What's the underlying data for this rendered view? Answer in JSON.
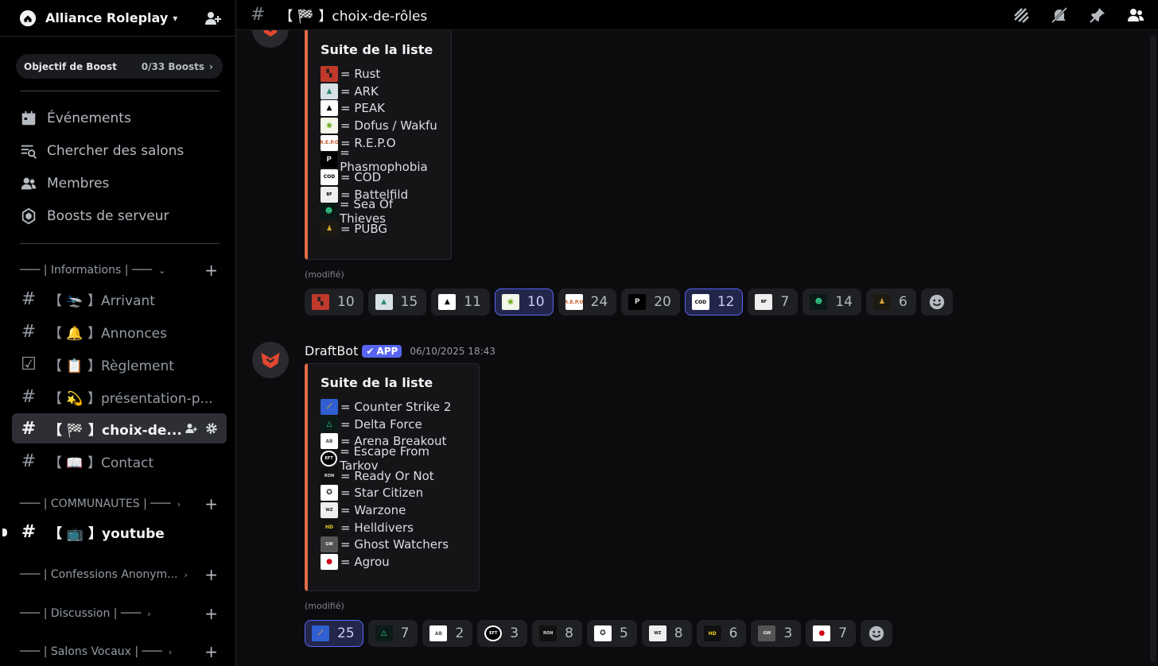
{
  "server": {
    "name": "Alliance Roleplay"
  },
  "boost": {
    "label": "Objectif de Boost",
    "count": "0/33 Boosts"
  },
  "menu": [
    {
      "label": "Événements",
      "icon": "calendar-icon"
    },
    {
      "label": "Chercher des salons",
      "icon": "channel-search-icon"
    },
    {
      "label": "Membres",
      "icon": "members-icon"
    },
    {
      "label": "Boosts de serveur",
      "icon": "boost-icon"
    }
  ],
  "categories": {
    "informations": "─── | Informations | ───",
    "communautes": "─── | COMMUNAUTES | ───",
    "confessions": "─── | Confessions Anonym...",
    "discussion": "─── | Discussion | ───",
    "vocaux": "─── | Salons Vocaux | ───"
  },
  "channels": {
    "arrivant": "【 🛬 】Arrivant",
    "annonces": "【 🔔 】Annonces",
    "reglement": "【 📋 】Règlement",
    "presentation": "【 💫 】présentation-p...",
    "choix": "【 🏁 】choix-de...",
    "contact": "【 📖 】Contact",
    "youtube": "【 📺 】youtube"
  },
  "topbar": {
    "title": "【 🏁 】choix-de-rôles"
  },
  "embed1": {
    "title": "Suite de la liste",
    "lines": [
      "= Rust",
      "= ARK",
      "= PEAK",
      "= Dofus / Wakfu",
      "= R.E.P.O",
      "= Phasmophobia",
      "= COD",
      "= Battelfild",
      "= Sea Of Thieves",
      "= PUBG"
    ],
    "edited": "(modifié)",
    "reactions": [
      "10",
      "15",
      "11",
      "10",
      "24",
      "20",
      "12",
      "7",
      "14",
      "6"
    ]
  },
  "message2": {
    "author": "DraftBot",
    "badge": "APP",
    "timestamp": "06/10/2025 18:43"
  },
  "embed2": {
    "title": "Suite de la liste",
    "lines": [
      "= Counter Strike 2",
      "= Delta Force",
      "= Arena Breakout",
      "= Escape From Tarkov",
      "= Ready Or Not",
      "= Star Citizen",
      "= Warzone",
      "= Helldivers",
      "= Ghost Watchers",
      "= Agrou"
    ],
    "edited": "(modifié)",
    "reactions": [
      "25",
      "7",
      "2",
      "3",
      "8",
      "5",
      "8",
      "6",
      "3",
      "7"
    ]
  },
  "colors": {
    "accent": "#5865f2",
    "embed_border": "#e06c4a"
  }
}
